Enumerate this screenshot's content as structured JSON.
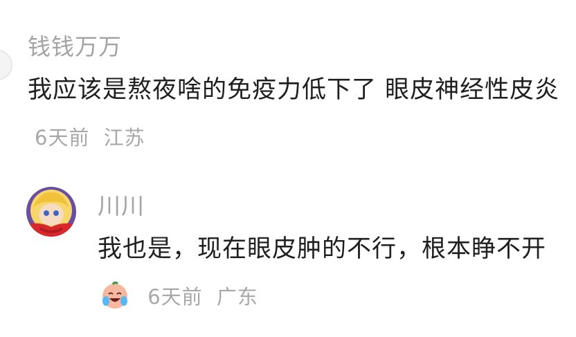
{
  "comment": {
    "username": "钱钱万万",
    "text": "我应该是熬夜啥的免疫力低下了 眼皮神经性皮炎",
    "time": "6天前",
    "location": "江苏"
  },
  "reply": {
    "username": "川川",
    "text": "我也是，现在眼皮肿的不行，根本睁不开",
    "emoji": "laughing-crying-face-emoji",
    "time": "6天前",
    "location": "广东"
  },
  "colors": {
    "text": "#1f1f1f",
    "meta": "#a8a8a8",
    "username": "#a3a3a3"
  }
}
